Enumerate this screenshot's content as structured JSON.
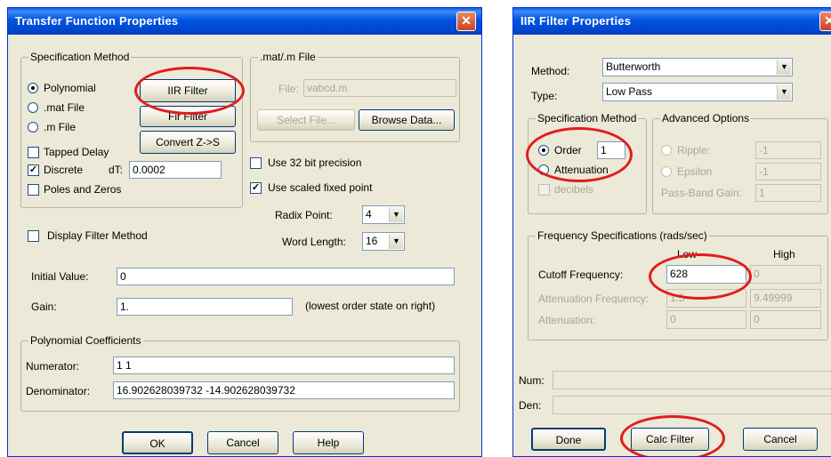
{
  "tf": {
    "title": "Transfer Function Properties",
    "close": "✕",
    "spec_method": {
      "title": "Specification Method",
      "polynomial": "Polynomial",
      "mat_file": ".mat File",
      "m_file": ".m File",
      "tapped_delay": "Tapped Delay",
      "discrete": "Discrete",
      "dt_label": "dT:",
      "dt_value": "0.0002",
      "poles_zeros": "Poles and Zeros",
      "iir_button": "IIR Filter",
      "fir_button": "Fir Filter",
      "convert_button": "Convert Z->S"
    },
    "mat_group": {
      "title": ".mat/.m File",
      "file_label": "File:",
      "file_value": "vabcd.m",
      "select_button": "Select File...",
      "browse_button": "Browse Data..."
    },
    "use_32bit": "Use 32 bit precision",
    "use_scaled": "Use scaled fixed point",
    "radix_label": "Radix Point:",
    "radix_value": "4",
    "word_label": "Word Length:",
    "word_value": "16",
    "display_filter": "Display Filter Method",
    "initial_label": "Initial Value:",
    "initial_value": "0",
    "gain_label": "Gain:",
    "gain_value": "1.",
    "gain_note": "(lowest order state on right)",
    "poly_group": {
      "title": "Polynomial Coefficients",
      "numerator_label": "Numerator:",
      "numerator_value": "1 1",
      "denominator_label": "Denominator:",
      "denominator_value": "16.902628039732 -14.902628039732"
    },
    "ok": "OK",
    "cancel": "Cancel",
    "help": "Help"
  },
  "iir": {
    "title": "IIR Filter Properties",
    "close": "✕",
    "method_label": "Method:",
    "method_value": "Butterworth",
    "type_label": "Type:",
    "type_value": "Low Pass",
    "spec_group": {
      "title": "Specification Method",
      "order": "Order",
      "order_value": "1",
      "attenuation": "Attenuation",
      "decibels": "decibels"
    },
    "adv_group": {
      "title": "Advanced Options",
      "ripple": "Ripple:",
      "ripple_value": "-1",
      "epsilon": "Epsilon",
      "epsilon_value": "-1",
      "passband_label": "Pass-Band Gain:",
      "passband_value": "1"
    },
    "freq_group": {
      "title": "Frequency Specifications (rads/sec)",
      "low_header": "Low",
      "high_header": "High",
      "cutoff_label": "Cutoff Frequency:",
      "cutoff_low": "628",
      "cutoff_high": "0",
      "atten_freq_label": "Attenuation Frequency:",
      "atten_freq_low": "1.5",
      "atten_freq_high": "9.49999",
      "attenuation_label": "Attenuation:",
      "attenuation_low": "0",
      "attenuation_high": "0"
    },
    "num_label": "Num:",
    "den_label": "Den:",
    "done": "Done",
    "calc": "Calc Filter",
    "cancel": "Cancel"
  },
  "colors": {
    "annotation": "#e21c1c",
    "titlebar": "#0054e3",
    "dialog_bg": "#ece9d8"
  }
}
